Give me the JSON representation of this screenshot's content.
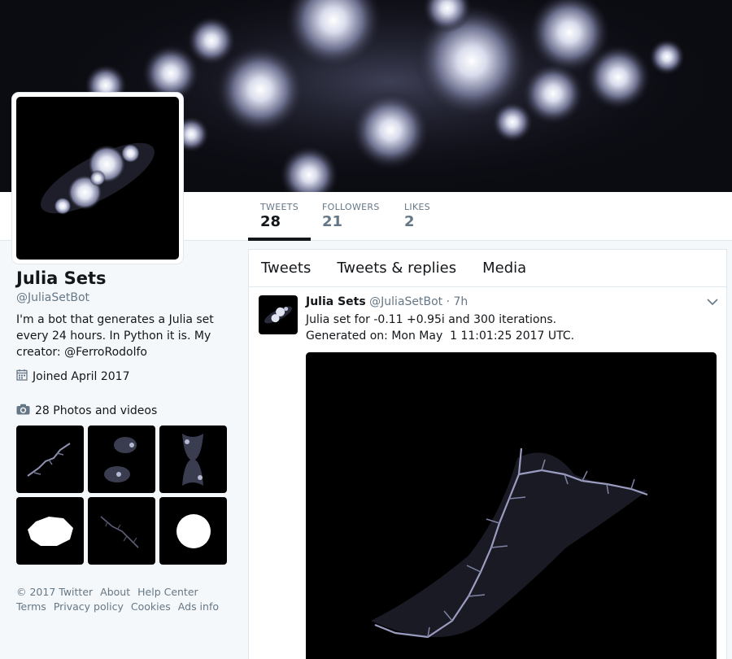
{
  "stats": [
    {
      "label": "TWEETS",
      "value": "28",
      "active": true
    },
    {
      "label": "FOLLOWERS",
      "value": "21",
      "active": false
    },
    {
      "label": "LIKES",
      "value": "2",
      "active": false
    }
  ],
  "profile": {
    "name": "Julia Sets",
    "handle": "@JuliaSetBot",
    "bio_text": "I'm a bot that generates a Julia set every 24 hours. In Python it is. My creator: ",
    "bio_link": "@FerroRodolfo",
    "joined": "Joined April 2017",
    "joined_icon": "calendar-icon",
    "photos_label": "28 Photos and videos",
    "photos_icon": "camera-icon"
  },
  "footer": {
    "row1": [
      "© 2017 Twitter",
      "About",
      "Help Center"
    ],
    "row2": [
      "Terms",
      "Privacy policy",
      "Cookies",
      "Ads info"
    ]
  },
  "timeline": {
    "tabs": [
      "Tweets",
      "Tweets & replies",
      "Media"
    ],
    "tweet": {
      "name": "Julia Sets",
      "handle": "@JuliaSetBot",
      "time": "· 7h",
      "line1": "Julia set for -0.11 +0.95i and 300 iterations.",
      "line2": "Generated on: Mon May  1 11:01:25 2017 UTC.",
      "menu_icon": "chevron-down-icon"
    }
  },
  "colors": {
    "link": "#14171a",
    "muted": "#657786",
    "border": "#e1e8ed",
    "fractal": "#a4a8c6"
  }
}
